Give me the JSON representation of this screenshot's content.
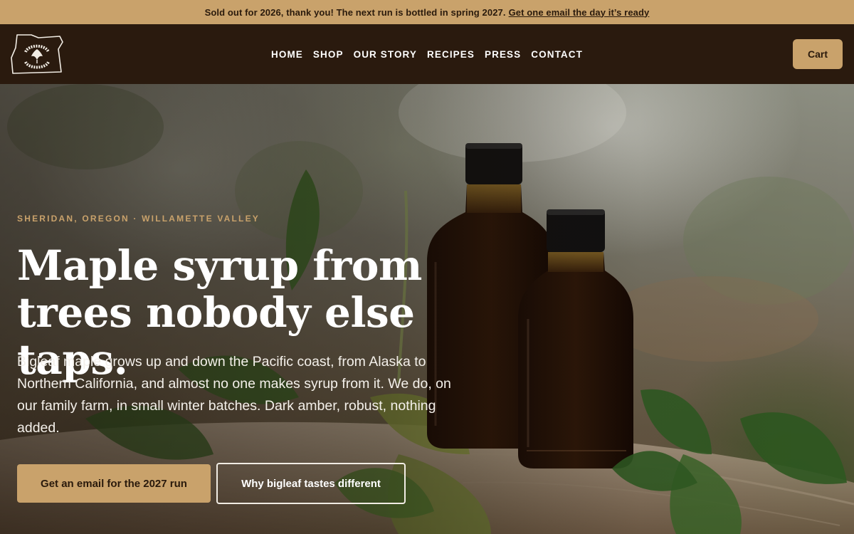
{
  "announcement": {
    "text": "Sold out for 2026, thank you! The next run is bottled in spring 2027.",
    "link": "Get one email the day it’s ready"
  },
  "nav": {
    "logo_icon": "oregon-state-logo-icon",
    "items": [
      {
        "label": "HOME"
      },
      {
        "label": "SHOP"
      },
      {
        "label": "OUR STORY"
      },
      {
        "label": "RECIPES"
      },
      {
        "label": "PRESS"
      },
      {
        "label": "CONTACT"
      }
    ],
    "cart_label": "Cart"
  },
  "hero": {
    "eyebrow": "SHERIDAN, OREGON · WILLAMETTE VALLEY",
    "headline": "Maple syrup from trees nobody else taps.",
    "lede": "Bigleaf maple grows up and down the Pacific coast, from Alaska to Northern California, and almost no one makes syrup from it. We do, on our family farm, in small winter batches. Dark amber, robust, nothing added.",
    "primary_cta": "Get an email for the 2027 run",
    "secondary_cta": "Why bigleaf tastes different"
  },
  "colors": {
    "accent": "#c9a26b",
    "nav_bg": "#2a1a0e",
    "text_dark": "#2a1a0c"
  }
}
